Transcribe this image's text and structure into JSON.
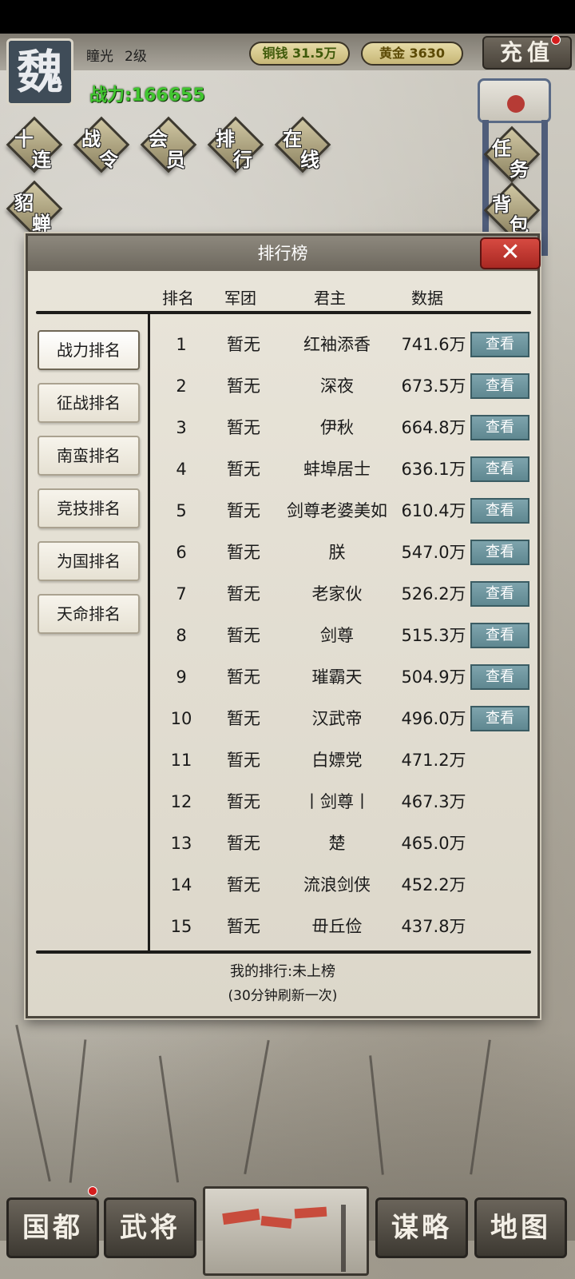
{
  "header": {
    "kingdom": "魏",
    "player_name": "瞳光",
    "player_level": "2级",
    "power": "战力:166655",
    "copper": "铜钱 31.5万",
    "gold": "黄金 3630",
    "recharge": "充值"
  },
  "menu": {
    "shilian": [
      "十",
      "连"
    ],
    "zhanling": [
      "战",
      "令"
    ],
    "huiyuan": [
      "会",
      "员"
    ],
    "paihang": [
      "排",
      "行"
    ],
    "zaixian": [
      "在",
      "线"
    ],
    "diaochan": [
      "貂",
      "蝉"
    ],
    "renwu": [
      "任",
      "务"
    ],
    "beibao": [
      "背",
      "包"
    ]
  },
  "modal": {
    "title": "排行榜",
    "close_symbol": "✕",
    "columns": {
      "rank": "排名",
      "corps": "军团",
      "lord": "君主",
      "data": "数据"
    },
    "tabs": [
      "战力排名",
      "征战排名",
      "南蛮排名",
      "竞技排名",
      "为国排名",
      "天命排名"
    ],
    "active_tab": "战力排名",
    "view_label": "查看",
    "rows": [
      {
        "rank": "1",
        "corps": "暂无",
        "lord": "红袖添香",
        "data": "741.6万",
        "view": true
      },
      {
        "rank": "2",
        "corps": "暂无",
        "lord": "深夜",
        "data": "673.5万",
        "view": true
      },
      {
        "rank": "3",
        "corps": "暂无",
        "lord": "伊秋",
        "data": "664.8万",
        "view": true
      },
      {
        "rank": "4",
        "corps": "暂无",
        "lord": "蚌埠居士",
        "data": "636.1万",
        "view": true
      },
      {
        "rank": "5",
        "corps": "暂无",
        "lord": "剑尊老婆美如",
        "data": "610.4万",
        "view": true
      },
      {
        "rank": "6",
        "corps": "暂无",
        "lord": "朕",
        "data": "547.0万",
        "view": true
      },
      {
        "rank": "7",
        "corps": "暂无",
        "lord": "老家伙",
        "data": "526.2万",
        "view": true
      },
      {
        "rank": "8",
        "corps": "暂无",
        "lord": "剑尊",
        "data": "515.3万",
        "view": true
      },
      {
        "rank": "9",
        "corps": "暂无",
        "lord": "璀霸天",
        "data": "504.9万",
        "view": true
      },
      {
        "rank": "10",
        "corps": "暂无",
        "lord": "汉武帝",
        "data": "496.0万",
        "view": true
      },
      {
        "rank": "11",
        "corps": "暂无",
        "lord": "白嫖党",
        "data": "471.2万",
        "view": false
      },
      {
        "rank": "12",
        "corps": "暂无",
        "lord": "丨剑尊丨",
        "data": "467.3万",
        "view": false
      },
      {
        "rank": "13",
        "corps": "暂无",
        "lord": "楚",
        "data": "465.0万",
        "view": false
      },
      {
        "rank": "14",
        "corps": "暂无",
        "lord": "流浪剑侠",
        "data": "452.2万",
        "view": false
      },
      {
        "rank": "15",
        "corps": "暂无",
        "lord": "毌丘俭",
        "data": "437.8万",
        "view": false
      }
    ],
    "my_rank": "我的排行:未上榜",
    "refresh_note": "(30分钟刷新一次)"
  },
  "bottom_nav": {
    "capital": "国都",
    "generals": "武将",
    "strategy": "谋略",
    "map": "地图"
  },
  "colors": {
    "power_green": "#41c630",
    "view_button": "#6f969f",
    "close_red": "#c23a32",
    "notification_red": "#d51d1d"
  }
}
